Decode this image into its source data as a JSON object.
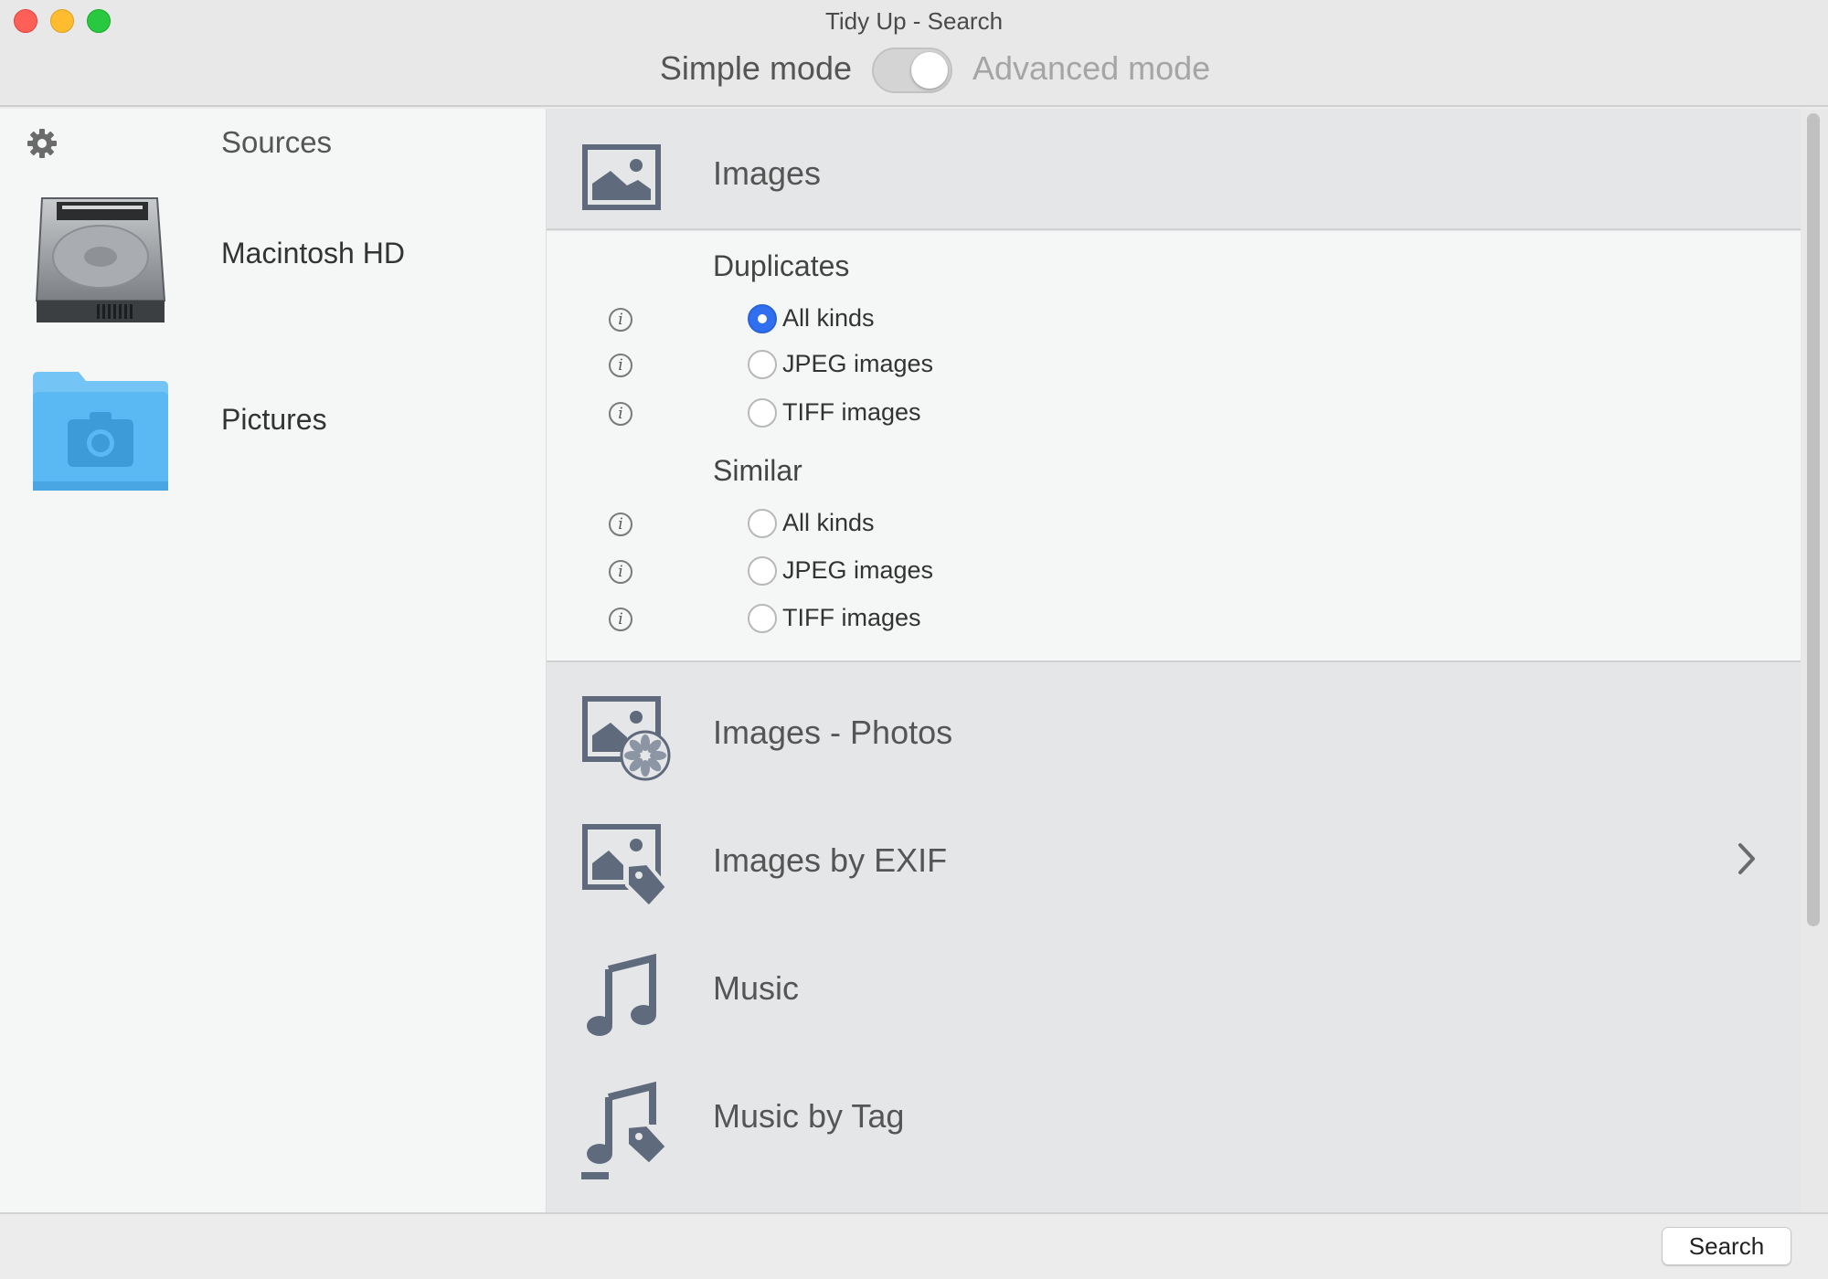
{
  "window": {
    "title": "Tidy Up - Search"
  },
  "mode": {
    "left_label": "Simple mode",
    "right_label": "Advanced mode",
    "selected": "Advanced mode"
  },
  "sidebar": {
    "header": "Sources",
    "sources": [
      {
        "name": "Macintosh HD",
        "icon": "hard-drive-icon"
      },
      {
        "name": "Pictures",
        "icon": "pictures-folder-icon"
      }
    ]
  },
  "categories": {
    "images": {
      "label": "Images",
      "icon": "image-icon"
    },
    "duplicates": {
      "title": "Duplicates",
      "options": [
        {
          "label": "All kinds",
          "checked": true
        },
        {
          "label": "JPEG images",
          "checked": false
        },
        {
          "label": "TIFF images",
          "checked": false
        }
      ]
    },
    "similar": {
      "title": "Similar",
      "options": [
        {
          "label": "All kinds",
          "checked": false
        },
        {
          "label": "JPEG images",
          "checked": false
        },
        {
          "label": "TIFF images",
          "checked": false
        }
      ]
    },
    "photos": {
      "label": "Images - Photos",
      "icon": "image-photos-icon"
    },
    "exif": {
      "label": "Images by EXIF",
      "icon": "image-tag-icon"
    },
    "music": {
      "label": "Music",
      "icon": "music-note-icon"
    },
    "music_tag": {
      "label": "Music by Tag",
      "icon": "music-tag-icon"
    }
  },
  "footer": {
    "search_label": "Search"
  },
  "colors": {
    "accent": "#2f6ff0",
    "icon_gray": "#5f6b7d",
    "folder_blue": "#5ab8f3"
  }
}
